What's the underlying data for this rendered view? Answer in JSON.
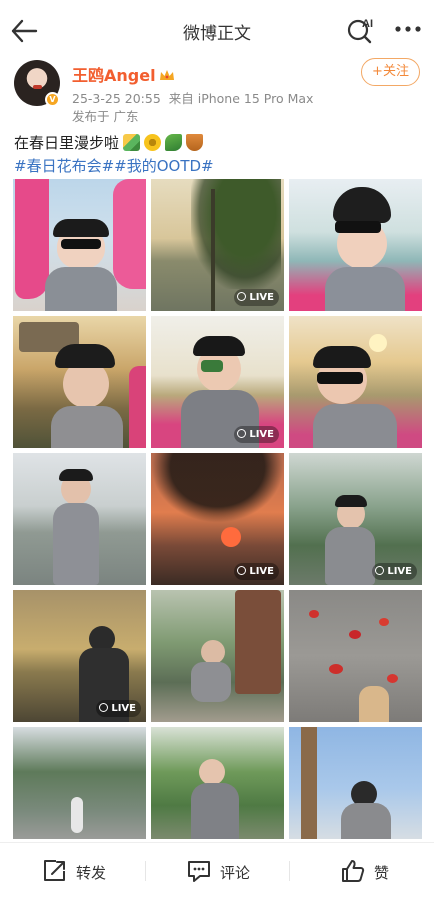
{
  "header": {
    "title": "微博正文",
    "ai_label": "AI"
  },
  "author": {
    "name": "王鸥Angel",
    "verified_badge": "V",
    "datetime": "25-3-25 20:55",
    "source": "来自 iPhone 15 Pro Max",
    "location": "发布于 广东",
    "follow_label": "+关注",
    "name_color": "#f25e2f"
  },
  "post": {
    "text": "在春日里漫步啦",
    "emojis": [
      "emoji-landscape",
      "emoji-sunflower",
      "emoji-herb",
      "emoji-boat"
    ],
    "hashtags": "#春日花布会##我的OOTD#"
  },
  "photos": [
    {
      "label": "pink-flamingos-selfie",
      "live": false
    },
    {
      "label": "lake-willow-view",
      "live": true
    },
    {
      "label": "paddle-boat-selfie",
      "live": false
    },
    {
      "label": "pavilion-sunset-cap",
      "live": false
    },
    {
      "label": "boat-sunglasses-pose",
      "live": true
    },
    {
      "label": "sunset-peace-sign",
      "live": false
    },
    {
      "label": "lakeside-standing",
      "live": false
    },
    {
      "label": "sunset-silhouette-trees",
      "live": true
    },
    {
      "label": "park-walk",
      "live": true
    },
    {
      "label": "silhouette-sunset-lake",
      "live": true
    },
    {
      "label": "crouching-by-sign",
      "live": false
    },
    {
      "label": "red-petals-pavement",
      "live": false
    },
    {
      "label": "tree-lined-street",
      "live": false
    },
    {
      "label": "tropical-garden-smile",
      "live": false
    },
    {
      "label": "palm-sky-reach",
      "live": false
    }
  ],
  "live_label": "LIVE",
  "actions": {
    "repost": "转发",
    "comment": "评论",
    "like": "赞"
  },
  "colors": {
    "hashtag": "#3a73c2",
    "follow": "#f3893a",
    "meta": "#8a8a8a"
  }
}
